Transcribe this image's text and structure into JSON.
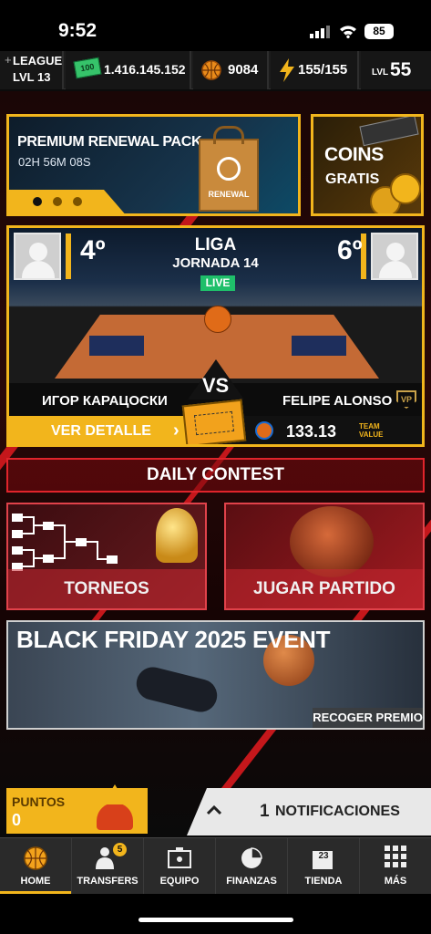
{
  "status": {
    "time": "9:52",
    "battery": "85"
  },
  "top": {
    "league_label": "LEAGUE",
    "league_level": "LVL 13",
    "cash_icon_text": "100",
    "cash": "1.416.145.152",
    "coins": "9084",
    "energy": "155/155",
    "level_prefix": "LVL",
    "level": "55"
  },
  "promo": {
    "title": "PREMIUM RENEWAL PACK",
    "timer": "02H 56M 08S",
    "bag_label": "RENEWAL",
    "coins_title": "COINS",
    "coins_subtitle": "GRATIS"
  },
  "match": {
    "competition": "LIGA",
    "round": "JORNADA 14",
    "live": "LIVE",
    "home_rank": "4º",
    "away_rank": "6º",
    "vs": "VS",
    "home_player": "ИГОР КАРАЦОСКИ",
    "away_player": "FELIPE ALONSO",
    "detail_button": "VER DETALLE",
    "team_value": "133.13",
    "team_value_label_1": "TEAM",
    "team_value_label_2": "VALUE",
    "badge": "VP"
  },
  "daily_contest": "DAILY CONTEST",
  "tiles": {
    "torneos": "TORNEOS",
    "jugar": "JUGAR PARTIDO"
  },
  "event": {
    "title": "BLACK FRIDAY 2025 EVENT",
    "action": "RECOGER PREMIO"
  },
  "puntos": {
    "label": "PUNTOS",
    "value": "0"
  },
  "notifications": {
    "count": "1",
    "label": "NOTIFICACIONES"
  },
  "nav": {
    "items": [
      {
        "label": "HOME",
        "icon": "basketball-icon"
      },
      {
        "label": "TRANSFERS",
        "icon": "transfers-icon",
        "badge": "5"
      },
      {
        "label": "EQUIPO",
        "icon": "team-icon"
      },
      {
        "label": "FINANZAS",
        "icon": "pie-chart-icon"
      },
      {
        "label": "TIENDA",
        "icon": "store-icon",
        "badge": "23"
      },
      {
        "label": "MÁS",
        "icon": "grid-icon"
      }
    ]
  },
  "colors": {
    "accent": "#f2b51c",
    "red": "#c4171b",
    "live": "#1fbf6a"
  }
}
